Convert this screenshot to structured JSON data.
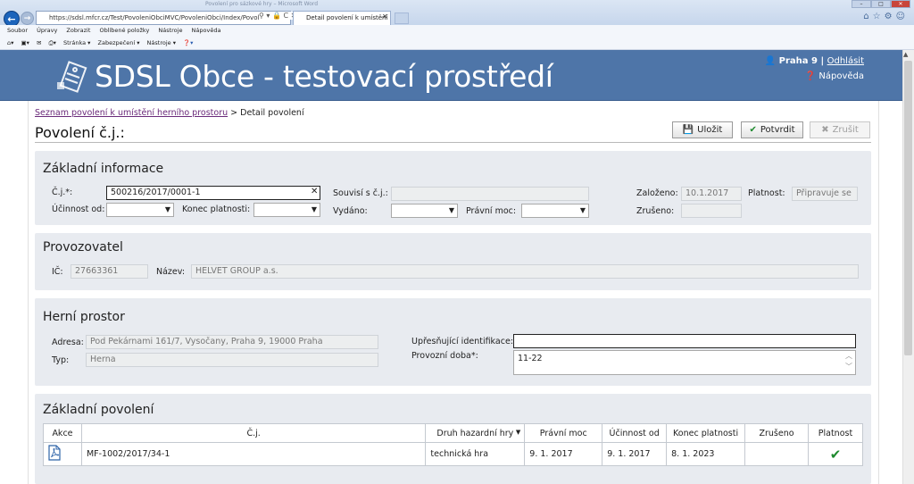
{
  "browser": {
    "ghost_title": "Povolení pro sázkové hry – Microsoft Word",
    "url": "https://sdsl.mfcr.cz/Test/PovoleniObciMVC/PovoleniObci/Index/PovoleniMistniDeta",
    "tab_title": "Detail povolení k umístění ...",
    "menu": [
      "Soubor",
      "Úpravy",
      "Zobrazit",
      "Oblíbené položky",
      "Nástroje",
      "Nápověda"
    ],
    "commands": [
      "Stránka ▾",
      "Zabezpečení ▾",
      "Nástroje ▾"
    ]
  },
  "header": {
    "app_title": "SDSL Obce - testovací prostředí",
    "user": "Praha 9",
    "logout": "Odhlásit",
    "help": "Nápověda",
    "color": "#4e75a8"
  },
  "breadcrumb": {
    "link": "Seznam povolení k umístění herního prostoru",
    "separator": ">",
    "current": "Detail povolení"
  },
  "page": {
    "title": "Povolení č.j.:",
    "buttons": {
      "save": "Uložit",
      "confirm": "Potvrdit",
      "cancel": "Zrušit"
    }
  },
  "basic_info": {
    "title": "Základní informace",
    "cj_label": "Č.j.*:",
    "cj_value": "500216/2017/0001-1",
    "related_label": "Souvisí s č.j.:",
    "related_value": "",
    "created_label": "Založeno:",
    "created_value": "10.1.2017",
    "validity_label": "Platnost:",
    "validity_value": "Připravuje se",
    "effective_label": "Účinnost od:",
    "end_label": "Konec platnosti:",
    "issued_label": "Vydáno:",
    "legal_label": "Právní moc:",
    "cancelled_label": "Zrušeno:",
    "cancelled_value": ""
  },
  "operator": {
    "title": "Provozovatel",
    "ic_label": "IČ:",
    "ic_value": "27663361",
    "name_label": "Název:",
    "name_value": "HELVET GROUP a.s."
  },
  "gaming_space": {
    "title": "Herní prostor",
    "address_label": "Adresa:",
    "address_value": "Pod Pekárnami 161/7, Vysočany, Praha 9, 19000 Praha",
    "type_label": "Typ:",
    "type_value": "Herna",
    "spec_label": "Upřesňující identifikace:",
    "spec_value": "",
    "hours_label": "Provozní doba*:",
    "hours_value": "11-22"
  },
  "base_permit": {
    "title": "Základní povolení",
    "columns": [
      "Akce",
      "Č.j.",
      "Druh hazardní hry",
      "Právní moc",
      "Účinnost od",
      "Konec platnosti",
      "Zrušeno",
      "Platnost"
    ],
    "rows": [
      {
        "cj": "MF-1002/2017/34-1",
        "game_type": "technická hra",
        "legal": "9. 1. 2017",
        "effective": "9. 1. 2017",
        "end": "8. 1. 2023",
        "cancelled": "",
        "valid": true
      }
    ]
  }
}
